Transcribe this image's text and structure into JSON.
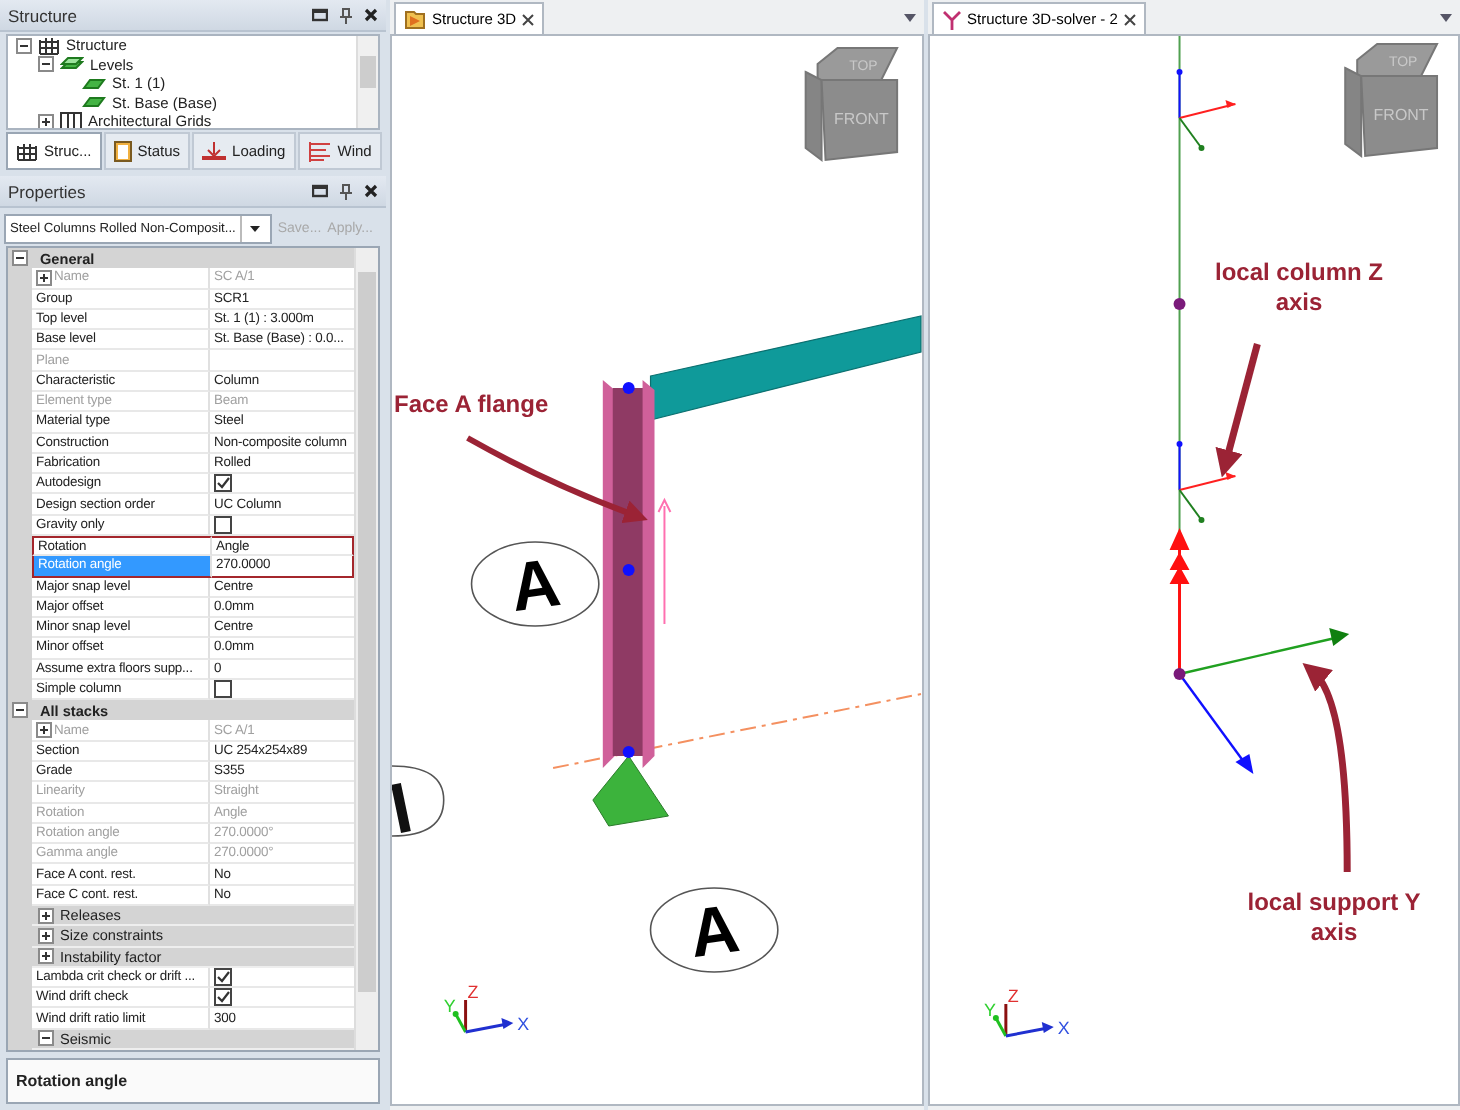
{
  "structure_panel": {
    "title": "Structure",
    "tree": [
      {
        "label": "Structure",
        "kind": "structure",
        "expanded": true,
        "children": [
          {
            "label": "Levels",
            "kind": "levels",
            "expanded": true,
            "children": [
              {
                "label": "St. 1 (1)",
                "kind": "level"
              },
              {
                "label": "St. Base (Base)",
                "kind": "level"
              }
            ]
          },
          {
            "label": "Architectural Grids",
            "kind": "grids",
            "expanded": false
          }
        ]
      }
    ],
    "tabs": [
      {
        "label": "Struc...",
        "selected": true
      },
      {
        "label": "Status",
        "selected": false
      },
      {
        "label": "Loading",
        "selected": false
      },
      {
        "label": "Wind",
        "selected": false
      }
    ]
  },
  "properties_panel": {
    "title": "Properties",
    "preset": "Steel Columns Rolled Non-Composit...",
    "buttons": [
      {
        "label": "Save...",
        "disabled": true
      },
      {
        "label": "Apply...",
        "disabled": true
      }
    ],
    "rows": [
      {
        "kind": "category",
        "label": "General",
        "expanded": true
      },
      {
        "kind": "expandable_property",
        "label": "Name",
        "value": "SC A/1",
        "disabled": true,
        "selected": false,
        "outlined": false
      },
      {
        "kind": "property",
        "label": "Group",
        "value": "SCR1",
        "disabled": false,
        "selected": false,
        "outlined": false
      },
      {
        "kind": "property",
        "label": "Top level",
        "value": "St. 1 (1) : 3.000m",
        "disabled": false,
        "selected": false,
        "outlined": false
      },
      {
        "kind": "property",
        "label": "Base level",
        "value": "St. Base (Base) : 0.0...",
        "disabled": false,
        "selected": false,
        "outlined": false
      },
      {
        "kind": "property",
        "label": "Plane",
        "value": "",
        "disabled": true,
        "selected": false,
        "outlined": false
      },
      {
        "kind": "property",
        "label": "Characteristic",
        "value": "Column",
        "disabled": false,
        "selected": false,
        "outlined": false
      },
      {
        "kind": "property",
        "label": "Element type",
        "value": "Beam",
        "disabled": true,
        "selected": false,
        "outlined": false
      },
      {
        "kind": "property",
        "label": "Material type",
        "value": "Steel",
        "disabled": false,
        "selected": false,
        "outlined": false
      },
      {
        "kind": "property",
        "label": "Construction",
        "value": "Non-composite column",
        "disabled": false,
        "selected": false,
        "outlined": false
      },
      {
        "kind": "property",
        "label": "Fabrication",
        "value": "Rolled",
        "disabled": false,
        "selected": false,
        "outlined": false
      },
      {
        "kind": "checkbox",
        "label": "Autodesign",
        "checked": true,
        "disabled": false,
        "selected": false,
        "outlined": false
      },
      {
        "kind": "property",
        "label": "Design section order",
        "value": "UC Column",
        "disabled": false,
        "selected": false,
        "outlined": false
      },
      {
        "kind": "checkbox",
        "label": "Gravity only",
        "checked": false,
        "disabled": false,
        "selected": false,
        "outlined": false
      },
      {
        "kind": "property",
        "label": "Rotation",
        "value": "Angle",
        "disabled": false,
        "selected": false,
        "outlined": true
      },
      {
        "kind": "property",
        "label": "Rotation angle",
        "value": "270.0000",
        "disabled": false,
        "selected": true,
        "outlined": true
      },
      {
        "kind": "property",
        "label": "Major snap level",
        "value": "Centre",
        "disabled": false,
        "selected": false,
        "outlined": false
      },
      {
        "kind": "property",
        "label": "Major offset",
        "value": "0.0mm",
        "disabled": false,
        "selected": false,
        "outlined": false
      },
      {
        "kind": "property",
        "label": "Minor snap level",
        "value": "Centre",
        "disabled": false,
        "selected": false,
        "outlined": false
      },
      {
        "kind": "property",
        "label": "Minor offset",
        "value": "0.0mm",
        "disabled": false,
        "selected": false,
        "outlined": false
      },
      {
        "kind": "property",
        "label": "Assume extra floors supp...",
        "value": "0",
        "disabled": false,
        "selected": false,
        "outlined": false
      },
      {
        "kind": "checkbox",
        "label": "Simple column",
        "checked": false,
        "disabled": false,
        "selected": false,
        "outlined": false
      },
      {
        "kind": "category",
        "label": "All stacks",
        "expanded": true
      },
      {
        "kind": "expandable_property",
        "label": "Name",
        "value": "SC A/1",
        "disabled": true,
        "selected": false,
        "outlined": false
      },
      {
        "kind": "property",
        "label": "Section",
        "value": "UC 254x254x89",
        "disabled": false,
        "selected": false,
        "outlined": false
      },
      {
        "kind": "property",
        "label": "Grade",
        "value": "S355",
        "disabled": false,
        "selected": false,
        "outlined": false
      },
      {
        "kind": "property",
        "label": "Linearity",
        "value": "Straight",
        "disabled": true,
        "selected": false,
        "outlined": false
      },
      {
        "kind": "property",
        "label": "Rotation",
        "value": "Angle",
        "disabled": true,
        "selected": false,
        "outlined": false
      },
      {
        "kind": "property",
        "label": "Rotation angle",
        "value": "270.0000°",
        "disabled": true,
        "selected": false,
        "outlined": false
      },
      {
        "kind": "property",
        "label": "Gamma angle",
        "value": "270.0000°",
        "disabled": true,
        "selected": false,
        "outlined": false
      },
      {
        "kind": "property",
        "label": "Face A cont. rest.",
        "value": "No",
        "disabled": false,
        "selected": false,
        "outlined": false
      },
      {
        "kind": "property",
        "label": "Face C cont. rest.",
        "value": "No",
        "disabled": false,
        "selected": false,
        "outlined": false
      },
      {
        "kind": "subgroup",
        "label": "Releases",
        "expanded": false
      },
      {
        "kind": "subgroup",
        "label": "Size constraints",
        "expanded": false
      },
      {
        "kind": "subgroup",
        "label": "Instability factor",
        "expanded": false
      },
      {
        "kind": "checkbox",
        "label": "Lambda crit check or drift ...",
        "checked": true,
        "disabled": false,
        "selected": false,
        "outlined": false
      },
      {
        "kind": "checkbox",
        "label": "Wind drift check",
        "checked": true,
        "disabled": false,
        "selected": false,
        "outlined": false
      },
      {
        "kind": "property",
        "label": "Wind drift ratio limit",
        "value": "300",
        "disabled": false,
        "selected": false,
        "outlined": false
      },
      {
        "kind": "subgroup",
        "label": "Seismic",
        "expanded": true
      }
    ],
    "description": "Rotation angle"
  },
  "views": [
    {
      "kind": "model",
      "title": "Structure 3D",
      "cube_top": "TOP",
      "cube_front": "FRONT",
      "axis_x": "X",
      "axis_y": "Y",
      "axis_z": "Z",
      "grid_labels": [
        "A",
        "A"
      ],
      "annotations": [
        "Face A flange"
      ]
    },
    {
      "kind": "solver",
      "title": "Structure 3D-solver - 2",
      "cube_top": "TOP",
      "cube_front": "FRONT",
      "axis_x": "X",
      "axis_y": "Y",
      "axis_z": "Z",
      "annotations": [
        "local column Z axis",
        "local support Y axis"
      ]
    }
  ]
}
